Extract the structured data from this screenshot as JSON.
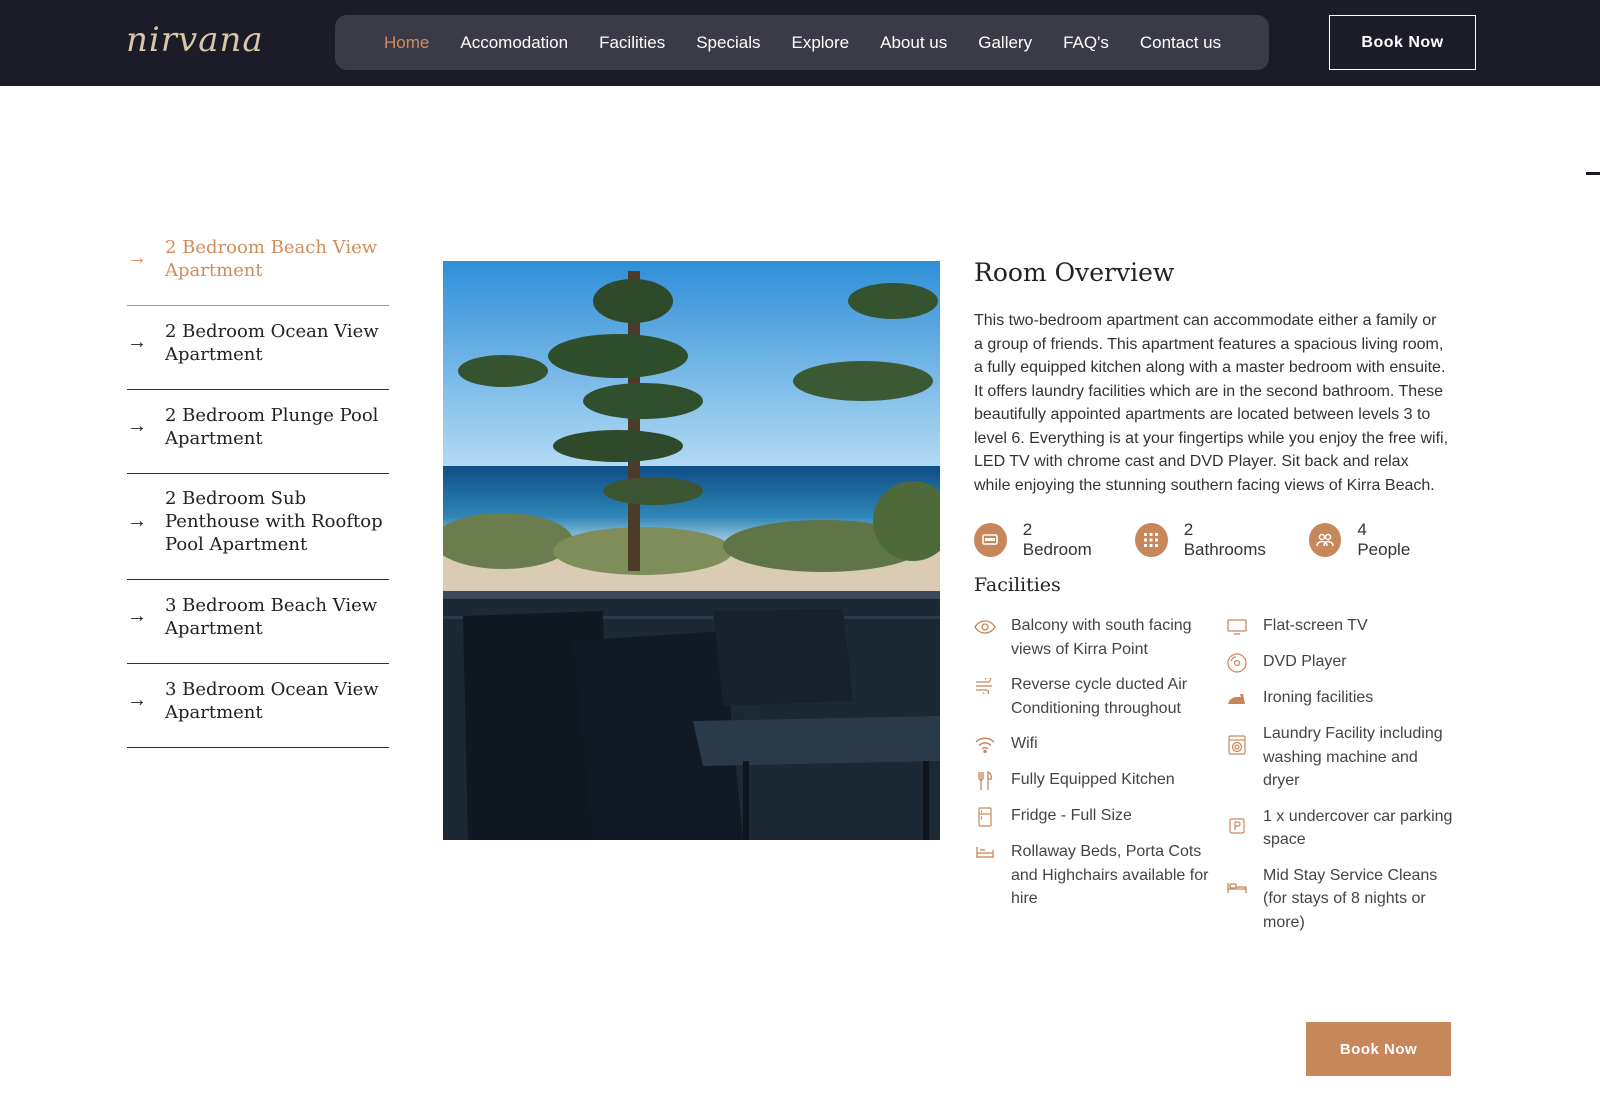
{
  "header": {
    "logo_text": "nirvana",
    "nav": [
      "Home",
      "Accomodation",
      "Facilities",
      "Specials",
      "Explore",
      "About us",
      "Gallery",
      "FAQ's",
      "Contact us"
    ],
    "book_label": "Book Now"
  },
  "sidebar": {
    "rooms": [
      "2 Bedroom Beach View Apartment",
      "2 Bedroom Ocean View Apartment",
      "2 Bedroom Plunge Pool Apartment",
      "2 Bedroom Sub Penthouse with Rooftop Pool Apartment",
      "3 Bedroom Beach View Apartment",
      "3 Bedroom Ocean View Apartment"
    ]
  },
  "overview": {
    "title": "Room Overview",
    "text": "This two-bedroom apartment can accommodate either a family or a group of friends. This apartment features a spacious living room, a fully equipped kitchen along with a master bedroom with ensuite. It offers laundry facilities which are in the second bathroom. These beautifully appointed apartments are located between levels 3 to level 6. Everything is at your fingertips while you enjoy the free wifi, LED TV with chrome cast and DVD Player. Sit back and relax while enjoying the stunning southern facing views of Kirra Beach."
  },
  "stats": [
    {
      "label": "2 Bedroom",
      "icon": "bed-icon"
    },
    {
      "label": "2 Bathrooms",
      "icon": "grid-icon"
    },
    {
      "label": "4 People",
      "icon": "people-icon"
    }
  ],
  "facilities": {
    "title": "Facilities",
    "left": [
      {
        "label": "Balcony with south facing views of Kirra Point",
        "icon": "eye-icon"
      },
      {
        "label": "Reverse cycle ducted Air Conditioning throughout",
        "icon": "wind-icon"
      },
      {
        "label": "Wifi",
        "icon": "wifi-icon"
      },
      {
        "label": "Fully Equipped Kitchen",
        "icon": "cutlery-icon"
      },
      {
        "label": "Fridge - Full Size",
        "icon": "fridge-icon"
      },
      {
        "label": "Rollaway Beds, Porta Cots and Highchairs available for hire",
        "icon": "cot-icon"
      }
    ],
    "right": [
      {
        "label": "Flat-screen TV",
        "icon": "tv-icon"
      },
      {
        "label": "DVD Player",
        "icon": "disc-icon"
      },
      {
        "label": "Ironing facilities",
        "icon": "iron-icon"
      },
      {
        "label": "Laundry Facility including washing machine and dryer",
        "icon": "washer-icon"
      },
      {
        "label": "1 x undercover car parking space",
        "icon": "parking-icon"
      },
      {
        "label": "Mid Stay Service Cleans (for stays of 8 nights or more)",
        "icon": "bed-icon"
      }
    ]
  },
  "book_bottom_label": "Book Now",
  "colors": {
    "accent": "#c7875a",
    "header_bg": "#1b1c28",
    "nav_bg": "#3a3b46"
  }
}
